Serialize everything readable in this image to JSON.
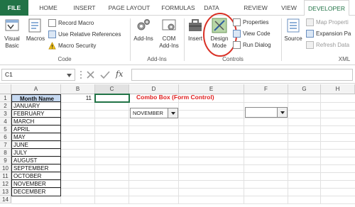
{
  "tabs": [
    "FILE",
    "HOME",
    "INSERT",
    "PAGE LAYOUT",
    "FORMULAS",
    "DATA",
    "REVIEW",
    "VIEW",
    "DEVELOPER"
  ],
  "active_tab": "DEVELOPER",
  "ribbon": {
    "code": {
      "label": "Code",
      "visual_basic": "Visual Basic",
      "macros": "Macros",
      "record_macro": "Record Macro",
      "use_relative_references": "Use Relative References",
      "macro_security": "Macro Security"
    },
    "addins": {
      "label": "Add-Ins",
      "addins": "Add-Ins",
      "com_addins": "COM Add-Ins"
    },
    "controls": {
      "label": "Controls",
      "insert": "Insert",
      "design_mode": "Design Mode",
      "properties": "Properties",
      "view_code": "View Code",
      "run_dialog": "Run Dialog"
    },
    "xml": {
      "label": "XML",
      "source": "Source",
      "map_properties": "Map Properti",
      "expansion_packs": "Expansion Pa",
      "refresh_data": "Refresh Data"
    }
  },
  "formula_bar": {
    "name_box": "C1",
    "fx": "fx",
    "value": ""
  },
  "sheet": {
    "columns": [
      "A",
      "B",
      "C",
      "D",
      "E",
      "F",
      "G",
      "H"
    ],
    "rows": [
      "1",
      "2",
      "3",
      "4",
      "5",
      "6",
      "7",
      "8",
      "9",
      "10",
      "11",
      "12",
      "13",
      "14"
    ],
    "header_cell": "Month Name",
    "months": [
      "JANUARY",
      "FEBRUARY",
      "MARCH",
      "APRIL",
      "MAY",
      "JUNE",
      "JULY",
      "AUGUST",
      "SEPTEMBER",
      "OCTOBER",
      "NOVEMBER",
      "DECEMBER"
    ],
    "b1_value": "11",
    "title_text": "Combo Box (Form Control)",
    "combo1_value": "NOVEMBER",
    "combo2_value": ""
  },
  "colors": {
    "file_tab": "#217346",
    "title_red": "#e02020",
    "highlight_circle": "#d93025"
  }
}
